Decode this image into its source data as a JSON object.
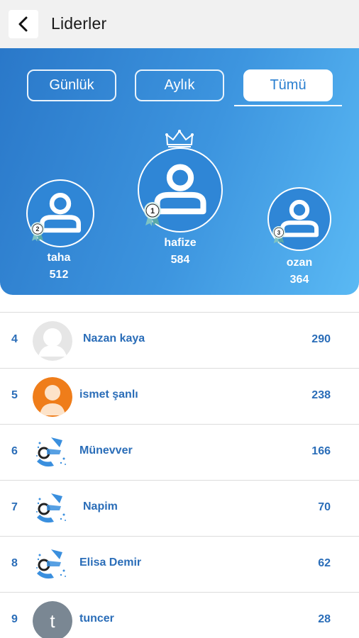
{
  "header": {
    "title": "Liderler",
    "back_icon": "chevron-left-icon"
  },
  "tabs": [
    {
      "label": "Günlük",
      "active": false
    },
    {
      "label": "Aylık",
      "active": false
    },
    {
      "label": "Tümü",
      "active": true
    }
  ],
  "podium": [
    {
      "rank": "1",
      "name": "hafize",
      "score": "584"
    },
    {
      "rank": "2",
      "name": "taha",
      "score": "512"
    },
    {
      "rank": "3",
      "name": "ozan",
      "score": "364"
    }
  ],
  "leaders": [
    {
      "rank": "4",
      "name": "Nazan kaya",
      "score": "290",
      "avatar": "default-gray-avatar"
    },
    {
      "rank": "5",
      "name": "ismet şanlı",
      "score": "238",
      "avatar": "orange-person-avatar"
    },
    {
      "rank": "6",
      "name": "Münevver",
      "score": "166",
      "avatar": "logo-avatar"
    },
    {
      "rank": "7",
      "name": "Napim",
      "score": "70",
      "avatar": "logo-avatar"
    },
    {
      "rank": "8",
      "name": "Elisa Demir",
      "score": "62",
      "avatar": "logo-avatar"
    },
    {
      "rank": "9",
      "name": "tuncer",
      "score": "28",
      "avatar": "letter-avatar",
      "avatar_letter": "t"
    }
  ],
  "colors": {
    "hero_start": "#2a78c9",
    "hero_end": "#5ab9f4",
    "list_text": "#2a6db8"
  }
}
